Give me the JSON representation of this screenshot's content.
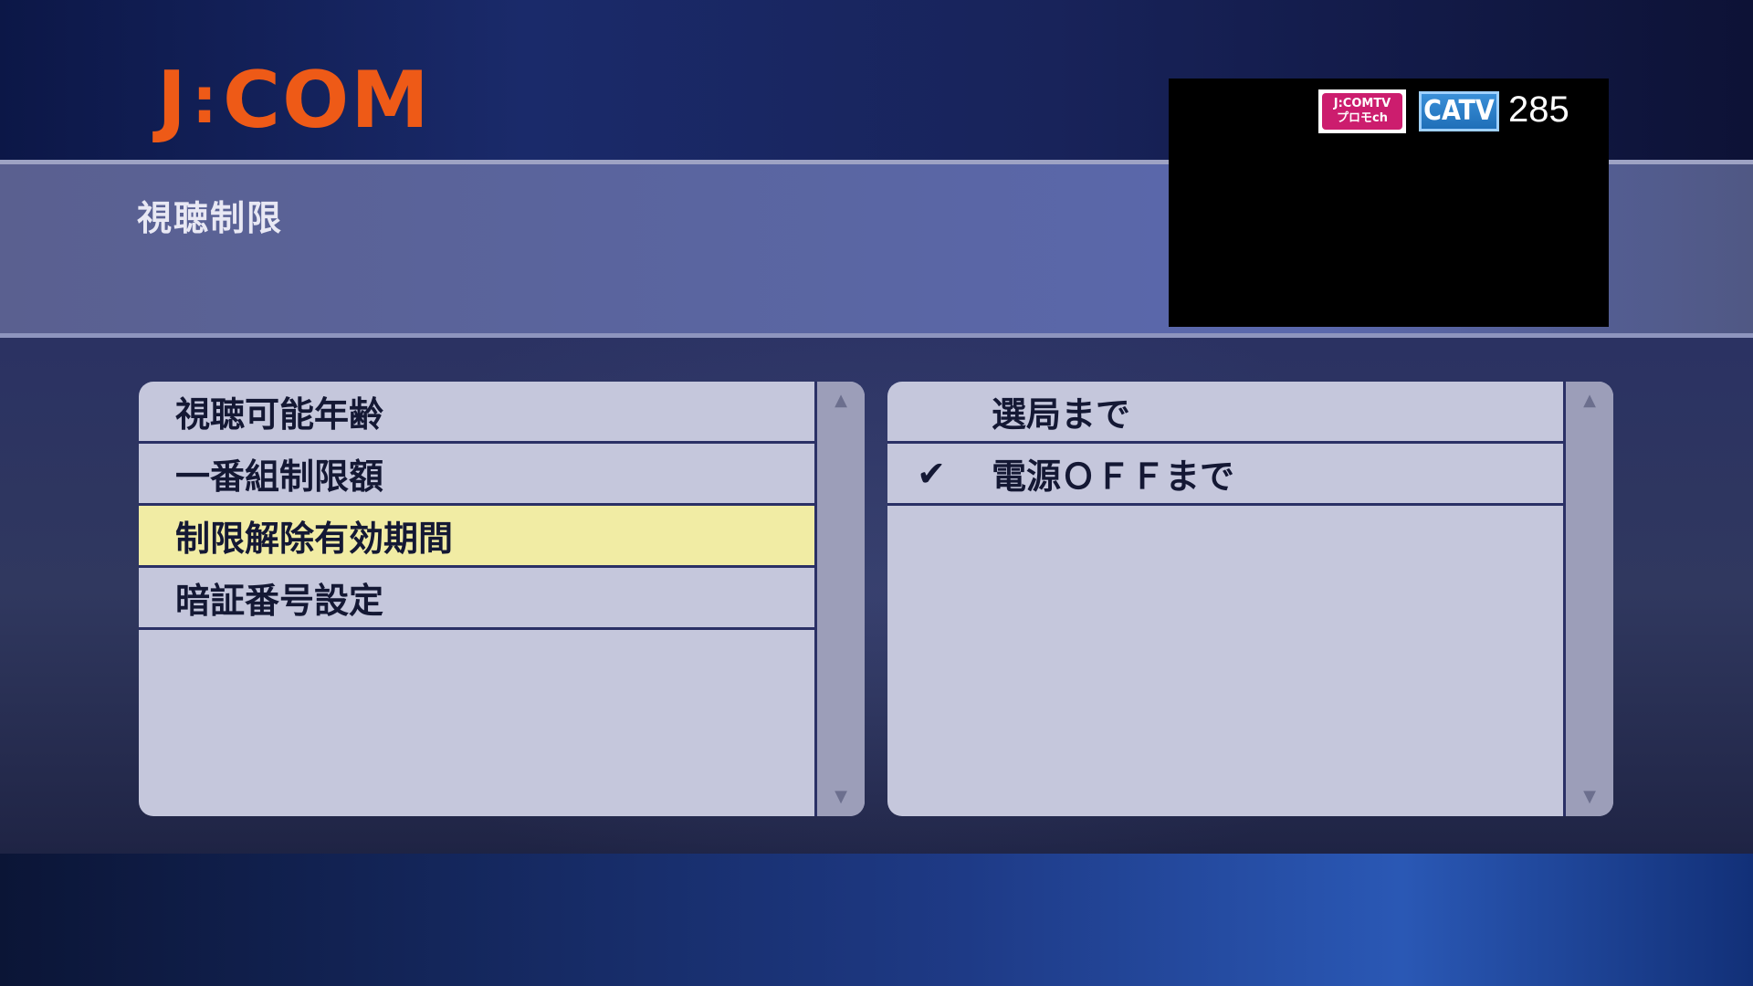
{
  "header": {
    "logo_text_left": "J",
    "logo_colon": ":",
    "logo_text_right": "COM",
    "title": "視聴制限"
  },
  "preview": {
    "badge_service_line1": "J:COMTV",
    "badge_service_line2": "プロモch",
    "badge_type": "CATV",
    "channel_number": "285"
  },
  "menu": {
    "items": [
      {
        "label": "視聴可能年齢",
        "selected": false
      },
      {
        "label": "一番組制限額",
        "selected": false
      },
      {
        "label": "制限解除有効期間",
        "selected": true
      },
      {
        "label": "暗証番号設定",
        "selected": false
      }
    ]
  },
  "options": {
    "items": [
      {
        "label": "選局まで",
        "checked": false,
        "check_mark": ""
      },
      {
        "label": "電源ＯＦＦまで",
        "checked": true,
        "check_mark": "✔"
      }
    ]
  },
  "scroll": {
    "up_icon": "▲",
    "down_icon": "▼"
  },
  "colors": {
    "logo": "#ee5a17",
    "selected_row": "#f1eca4",
    "panel": "#c5c7dc"
  }
}
